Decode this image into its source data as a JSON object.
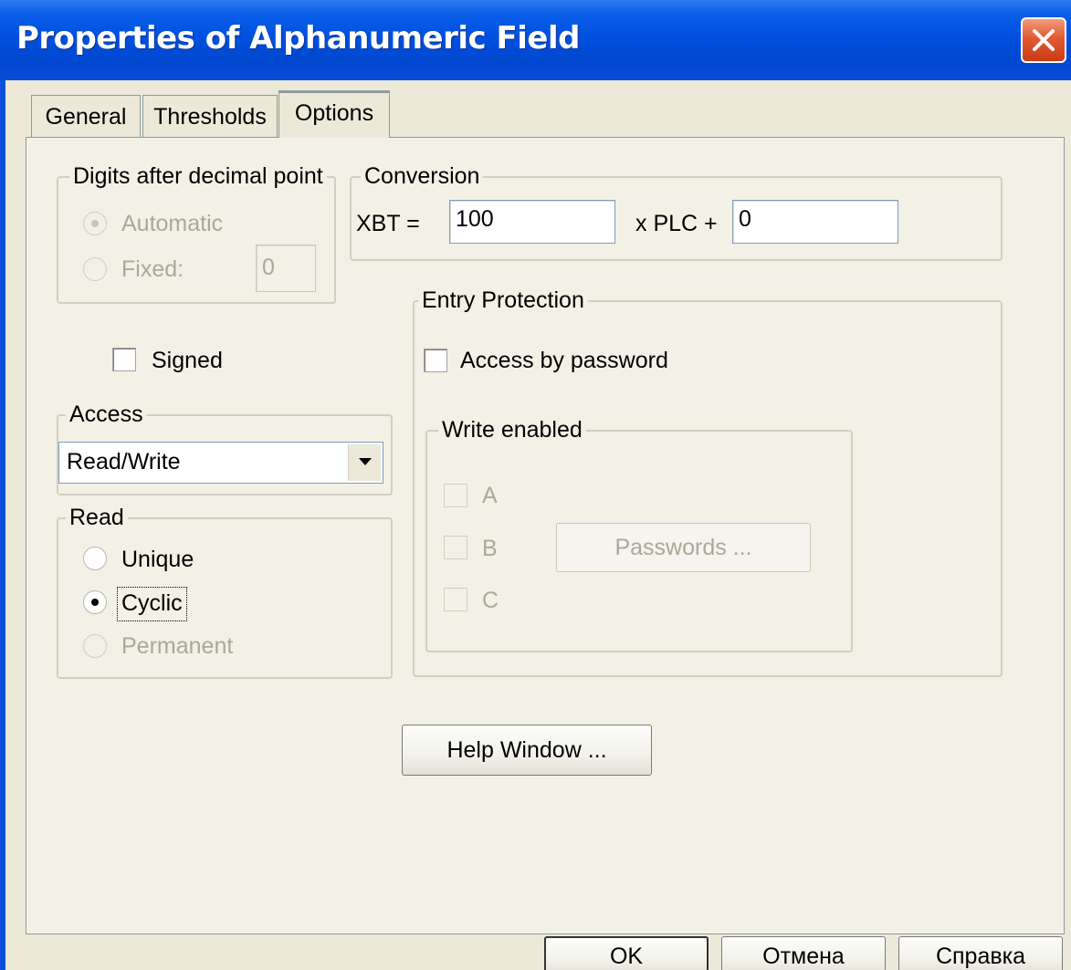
{
  "window": {
    "title": "Properties of Alphanumeric Field"
  },
  "tabs": [
    {
      "label": "General"
    },
    {
      "label": "Thresholds"
    },
    {
      "label": "Options"
    }
  ],
  "digits": {
    "legend": "Digits after decimal point",
    "automatic_label": "Automatic",
    "fixed_label": "Fixed:",
    "fixed_value": "0",
    "selected": "Automatic",
    "enabled": false
  },
  "conversion": {
    "legend": "Conversion",
    "xbt_label": "XBT =",
    "multiplier": "100",
    "plc_label": "x PLC +",
    "offset": "0"
  },
  "signed": {
    "label": "Signed",
    "checked": false
  },
  "access": {
    "legend": "Access",
    "value": "Read/Write"
  },
  "read": {
    "legend": "Read",
    "unique_label": "Unique",
    "cyclic_label": "Cyclic",
    "permanent_label": "Permanent",
    "selected": "Cyclic"
  },
  "entry_protection": {
    "legend": "Entry Protection",
    "access_by_password_label": "Access by password",
    "access_by_password_checked": false,
    "write_enabled": {
      "legend": "Write enabled",
      "a_label": "A",
      "b_label": "B",
      "c_label": "C",
      "passwords_button": "Passwords ..."
    }
  },
  "help_button": "Help Window ...",
  "footer": {
    "ok": "OK",
    "cancel": "Отмена",
    "help": "Справка"
  },
  "colors": {
    "titlebar": "#0050e0",
    "close": "#e25a32",
    "face": "#ece9d8"
  }
}
